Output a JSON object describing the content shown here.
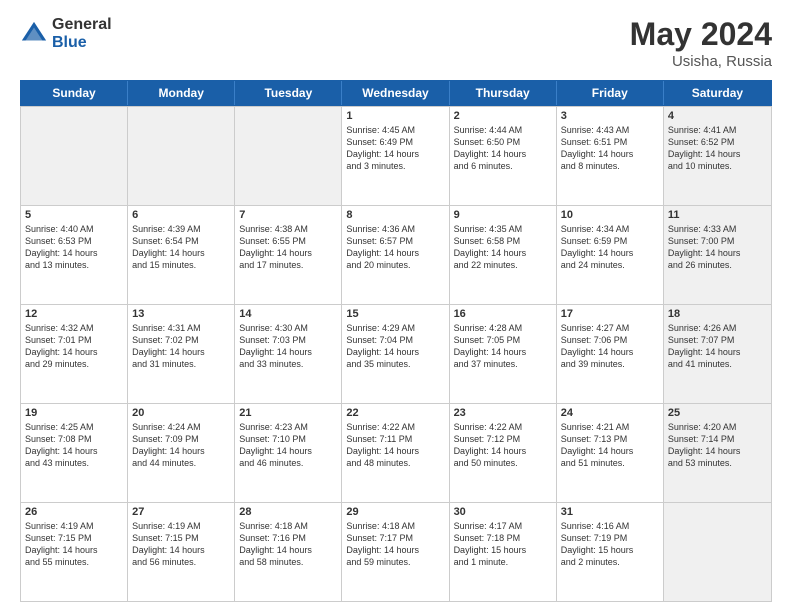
{
  "logo": {
    "general": "General",
    "blue": "Blue"
  },
  "title": "May 2024",
  "subtitle": "Usisha, Russia",
  "header_days": [
    "Sunday",
    "Monday",
    "Tuesday",
    "Wednesday",
    "Thursday",
    "Friday",
    "Saturday"
  ],
  "weeks": [
    [
      {
        "day": "",
        "info": "",
        "shaded": true
      },
      {
        "day": "",
        "info": "",
        "shaded": true
      },
      {
        "day": "",
        "info": "",
        "shaded": true
      },
      {
        "day": "1",
        "info": "Sunrise: 4:45 AM\nSunset: 6:49 PM\nDaylight: 14 hours\nand 3 minutes."
      },
      {
        "day": "2",
        "info": "Sunrise: 4:44 AM\nSunset: 6:50 PM\nDaylight: 14 hours\nand 6 minutes."
      },
      {
        "day": "3",
        "info": "Sunrise: 4:43 AM\nSunset: 6:51 PM\nDaylight: 14 hours\nand 8 minutes."
      },
      {
        "day": "4",
        "info": "Sunrise: 4:41 AM\nSunset: 6:52 PM\nDaylight: 14 hours\nand 10 minutes.",
        "shaded": true
      }
    ],
    [
      {
        "day": "5",
        "info": "Sunrise: 4:40 AM\nSunset: 6:53 PM\nDaylight: 14 hours\nand 13 minutes."
      },
      {
        "day": "6",
        "info": "Sunrise: 4:39 AM\nSunset: 6:54 PM\nDaylight: 14 hours\nand 15 minutes."
      },
      {
        "day": "7",
        "info": "Sunrise: 4:38 AM\nSunset: 6:55 PM\nDaylight: 14 hours\nand 17 minutes."
      },
      {
        "day": "8",
        "info": "Sunrise: 4:36 AM\nSunset: 6:57 PM\nDaylight: 14 hours\nand 20 minutes."
      },
      {
        "day": "9",
        "info": "Sunrise: 4:35 AM\nSunset: 6:58 PM\nDaylight: 14 hours\nand 22 minutes."
      },
      {
        "day": "10",
        "info": "Sunrise: 4:34 AM\nSunset: 6:59 PM\nDaylight: 14 hours\nand 24 minutes."
      },
      {
        "day": "11",
        "info": "Sunrise: 4:33 AM\nSunset: 7:00 PM\nDaylight: 14 hours\nand 26 minutes.",
        "shaded": true
      }
    ],
    [
      {
        "day": "12",
        "info": "Sunrise: 4:32 AM\nSunset: 7:01 PM\nDaylight: 14 hours\nand 29 minutes."
      },
      {
        "day": "13",
        "info": "Sunrise: 4:31 AM\nSunset: 7:02 PM\nDaylight: 14 hours\nand 31 minutes."
      },
      {
        "day": "14",
        "info": "Sunrise: 4:30 AM\nSunset: 7:03 PM\nDaylight: 14 hours\nand 33 minutes."
      },
      {
        "day": "15",
        "info": "Sunrise: 4:29 AM\nSunset: 7:04 PM\nDaylight: 14 hours\nand 35 minutes."
      },
      {
        "day": "16",
        "info": "Sunrise: 4:28 AM\nSunset: 7:05 PM\nDaylight: 14 hours\nand 37 minutes."
      },
      {
        "day": "17",
        "info": "Sunrise: 4:27 AM\nSunset: 7:06 PM\nDaylight: 14 hours\nand 39 minutes."
      },
      {
        "day": "18",
        "info": "Sunrise: 4:26 AM\nSunset: 7:07 PM\nDaylight: 14 hours\nand 41 minutes.",
        "shaded": true
      }
    ],
    [
      {
        "day": "19",
        "info": "Sunrise: 4:25 AM\nSunset: 7:08 PM\nDaylight: 14 hours\nand 43 minutes."
      },
      {
        "day": "20",
        "info": "Sunrise: 4:24 AM\nSunset: 7:09 PM\nDaylight: 14 hours\nand 44 minutes."
      },
      {
        "day": "21",
        "info": "Sunrise: 4:23 AM\nSunset: 7:10 PM\nDaylight: 14 hours\nand 46 minutes."
      },
      {
        "day": "22",
        "info": "Sunrise: 4:22 AM\nSunset: 7:11 PM\nDaylight: 14 hours\nand 48 minutes."
      },
      {
        "day": "23",
        "info": "Sunrise: 4:22 AM\nSunset: 7:12 PM\nDaylight: 14 hours\nand 50 minutes."
      },
      {
        "day": "24",
        "info": "Sunrise: 4:21 AM\nSunset: 7:13 PM\nDaylight: 14 hours\nand 51 minutes."
      },
      {
        "day": "25",
        "info": "Sunrise: 4:20 AM\nSunset: 7:14 PM\nDaylight: 14 hours\nand 53 minutes.",
        "shaded": true
      }
    ],
    [
      {
        "day": "26",
        "info": "Sunrise: 4:19 AM\nSunset: 7:15 PM\nDaylight: 14 hours\nand 55 minutes."
      },
      {
        "day": "27",
        "info": "Sunrise: 4:19 AM\nSunset: 7:15 PM\nDaylight: 14 hours\nand 56 minutes."
      },
      {
        "day": "28",
        "info": "Sunrise: 4:18 AM\nSunset: 7:16 PM\nDaylight: 14 hours\nand 58 minutes."
      },
      {
        "day": "29",
        "info": "Sunrise: 4:18 AM\nSunset: 7:17 PM\nDaylight: 14 hours\nand 59 minutes."
      },
      {
        "day": "30",
        "info": "Sunrise: 4:17 AM\nSunset: 7:18 PM\nDaylight: 15 hours\nand 1 minute."
      },
      {
        "day": "31",
        "info": "Sunrise: 4:16 AM\nSunset: 7:19 PM\nDaylight: 15 hours\nand 2 minutes."
      },
      {
        "day": "",
        "info": "",
        "shaded": true
      }
    ]
  ]
}
